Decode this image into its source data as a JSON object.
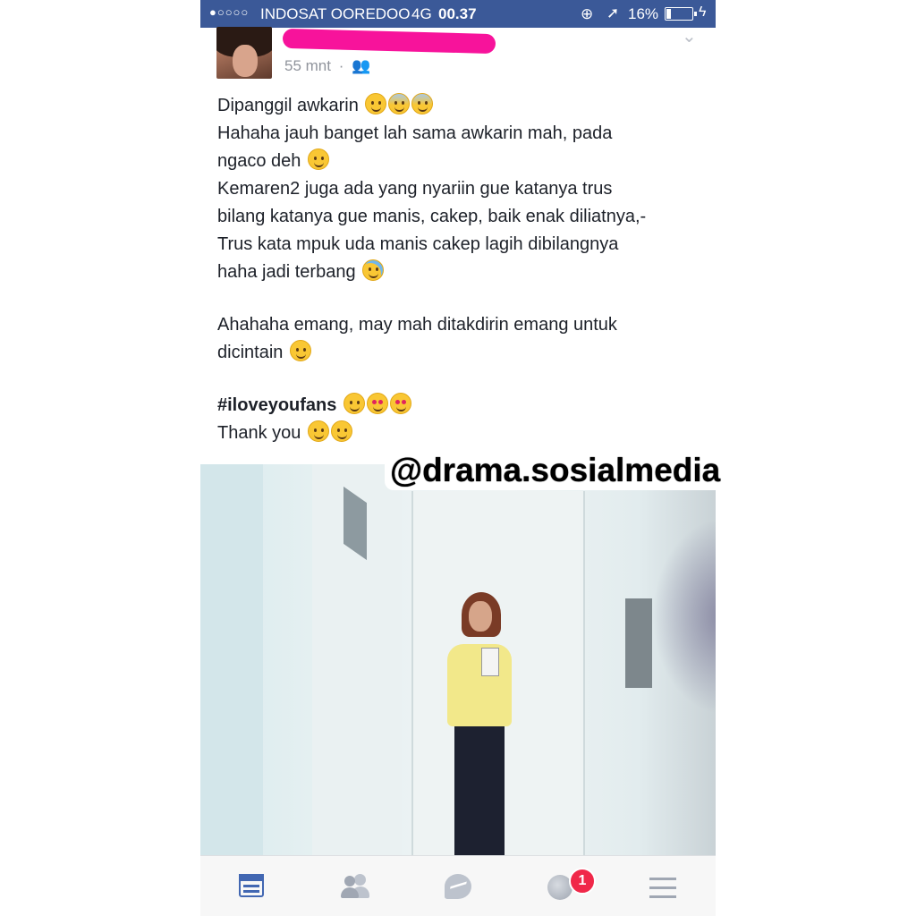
{
  "status_bar": {
    "signal_dots": "●○○○○",
    "carrier": "INDOSAT OOREDOO",
    "network": "4G",
    "time": "00.37",
    "battery_percent": "16%",
    "battery_level": 0.16,
    "icons": [
      "rotation-lock-icon",
      "location-arrow-icon",
      "battery-icon",
      "charging-bolt-icon"
    ]
  },
  "post": {
    "author_name_redacted": true,
    "time_ago": "55 mnt",
    "separator": "·",
    "audience_icon": "friends-icon",
    "lines": [
      {
        "text": "Dipanggil awkarin",
        "emoji": [
          "grinning-face",
          "screaming-face",
          "fearful-face"
        ]
      },
      {
        "text": "Hahaha jauh banget lah sama awkarin mah, pada"
      },
      {
        "text": "ngaco deh",
        "emoji": [
          "grinning-face"
        ]
      },
      {
        "text": "Kemaren2 juga ada yang nyariin gue katanya trus"
      },
      {
        "text": "bilang katanya gue manis, cakep, baik enak diliatnya,-"
      },
      {
        "text": "Trus kata mpuk uda manis cakep lagih dibilangnya"
      },
      {
        "text": "haha jadi terbang",
        "emoji": [
          "tears-of-joy-face"
        ]
      },
      {
        "text": "Ahahaha emang, may mah ditakdirin emang untuk"
      },
      {
        "text": "dicintain",
        "emoji": [
          "winking-face"
        ]
      },
      {
        "text": "#iloveyoufans",
        "emoji": [
          "winking-face",
          "heart-eyes-face",
          "kissing-face"
        ]
      },
      {
        "text": "Thank you",
        "emoji": [
          "smiling-face",
          "winking-face"
        ]
      }
    ]
  },
  "watermark": "@drama.sosialmedia",
  "bottom_nav": {
    "items": [
      "news-feed-icon",
      "friends-icon",
      "messenger-icon",
      "notifications-globe-icon",
      "menu-icon"
    ],
    "notification_count": "1",
    "active_color": "#4267b2",
    "inactive_color": "#a0a7b3",
    "badge_color": "#f02849"
  },
  "colors": {
    "status_bar": "#3b5998",
    "redaction": "#f7139b",
    "text": "#1d2129",
    "meta": "#90949c"
  }
}
